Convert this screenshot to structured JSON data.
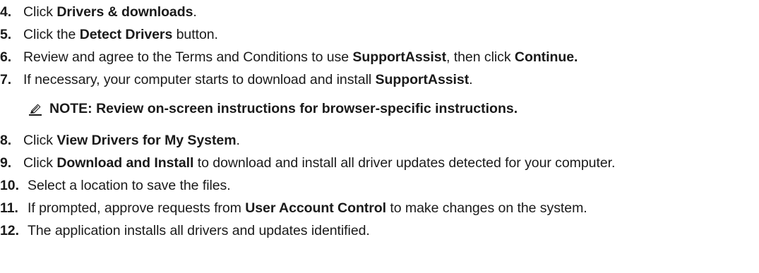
{
  "steps": [
    {
      "num": "4.",
      "parts": [
        "Click ",
        "Drivers & downloads",
        "."
      ]
    },
    {
      "num": "5.",
      "parts": [
        "Click the ",
        "Detect Drivers",
        " button."
      ]
    },
    {
      "num": "6.",
      "parts": [
        "Review and agree to the Terms and Conditions to use ",
        "SupportAssist",
        ", then click ",
        "Continue",
        "."
      ]
    },
    {
      "num": "7.",
      "parts": [
        "If necessary, your computer starts to download and install ",
        "SupportAssist",
        "."
      ]
    },
    {
      "num": "8.",
      "parts": [
        "Click ",
        "View Drivers for My System",
        "."
      ]
    },
    {
      "num": "9.",
      "parts": [
        "Click ",
        "Download and Install",
        " to download and install all driver updates detected for your computer."
      ]
    },
    {
      "num": "10.",
      "text": "Select a location to save the files."
    },
    {
      "num": "11.",
      "parts": [
        "If prompted, approve requests from ",
        "User Account Control",
        " to make changes on the system."
      ]
    },
    {
      "num": "12.",
      "text": "The application installs all drivers and updates identified."
    }
  ],
  "note": {
    "icon": "note-pencil-icon",
    "text": "NOTE: Review on-screen instructions for browser-specific instructions."
  }
}
